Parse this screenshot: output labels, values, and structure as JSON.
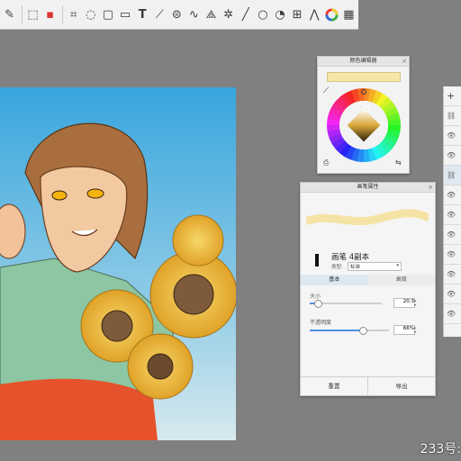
{
  "toolbar": {
    "icons": [
      "brush-tool-icon",
      "selection-icon",
      "new-file-icon",
      "crop-icon",
      "lasso-icon",
      "transform-icon",
      "layer-icon",
      "text-icon",
      "pen-icon",
      "shape-icon",
      "brush-stroke-icon",
      "perspective-icon",
      "symmetry-icon",
      "line-icon",
      "circle-icon",
      "fill-icon",
      "adjust-icon",
      "flip-icon",
      "color-wheel-icon",
      "grid-icon"
    ]
  },
  "color_editor": {
    "title": "颜色编辑器",
    "swatch_color": "#f7e7a6"
  },
  "brush_panel": {
    "title": "画笔属性",
    "brush_name": "画笔 4副本",
    "type_label": "类型:",
    "type_value": "标准",
    "tabs": [
      "基本",
      "高级"
    ],
    "size_label": "大小",
    "size_value": "20.3",
    "opacity_label": "不透明度",
    "opacity_value": "66%",
    "size_level": 0.1,
    "opacity_level": 0.66,
    "reset_label": "重置",
    "export_label": "导出"
  },
  "layers_panel": {
    "add_label": "+"
  },
  "watermark": {
    "text": "233号:"
  },
  "colors": {
    "background": "#808080",
    "sky_top": "#38a6de",
    "sky_bottom": "#c8e6ee",
    "accent_orange": "#e6522b",
    "sunflower": "#f2c23a"
  }
}
